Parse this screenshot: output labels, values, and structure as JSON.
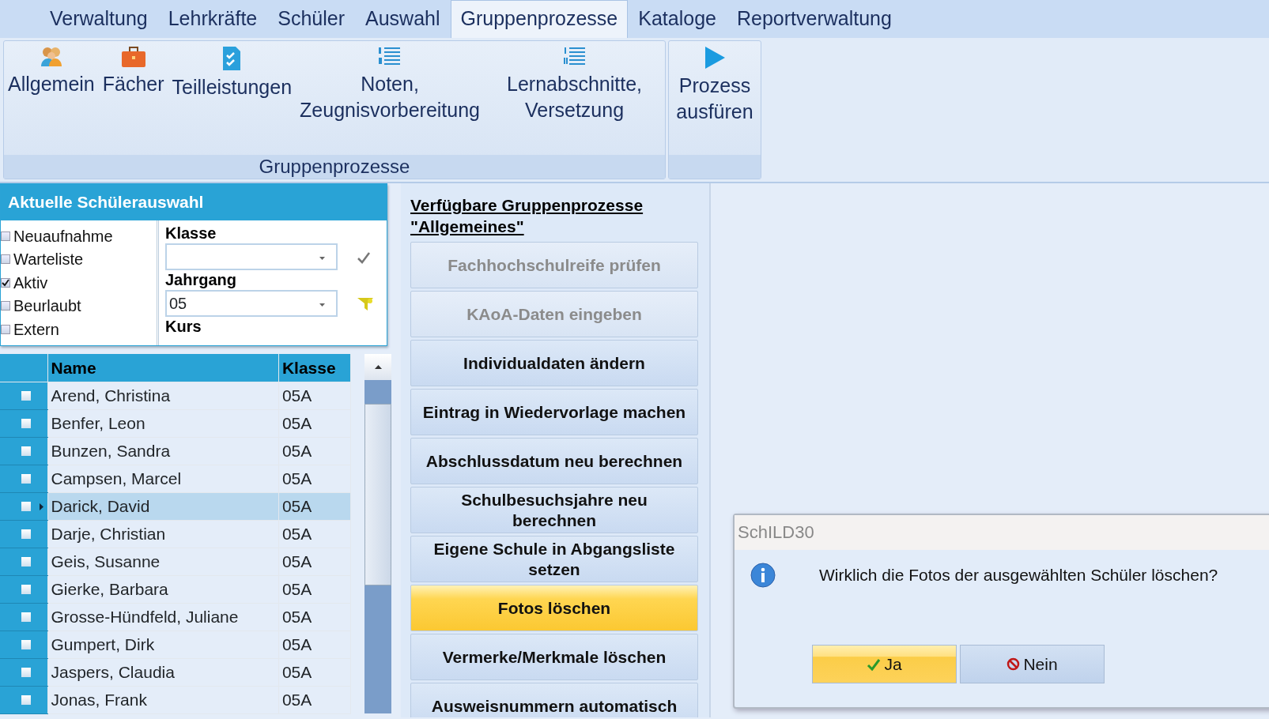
{
  "menu_tabs": [
    {
      "label": "Verwaltung",
      "selected": false
    },
    {
      "label": "Lehrkräfte",
      "selected": false
    },
    {
      "label": "Schüler",
      "selected": false
    },
    {
      "label": "Auswahl",
      "selected": false
    },
    {
      "label": "Gruppenprozesse",
      "selected": true
    },
    {
      "label": "Kataloge",
      "selected": false
    },
    {
      "label": "Reportverwaltung",
      "selected": false
    }
  ],
  "ribbon": {
    "groups": [
      {
        "label": "Gruppenprozesse",
        "items": [
          {
            "label": "Allgemein",
            "kind": "people"
          },
          {
            "label": "Fächer",
            "kind": "briefcase"
          },
          {
            "label": "Teilleistungen",
            "kind": "checklist"
          },
          {
            "label": "Noten, Zeugnisvorbereitung",
            "kind": "numbered"
          },
          {
            "label": "Lernabschnitte, Versetzung",
            "kind": "roman"
          }
        ]
      },
      {
        "items": [
          {
            "label": "Prozess ausfüren",
            "kind": "play"
          }
        ]
      }
    ]
  },
  "selection_panel": {
    "title": "Aktuelle Schülerauswahl",
    "statuses": [
      {
        "label": "Neuaufnahme",
        "checked": false
      },
      {
        "label": "Warteliste",
        "checked": false
      },
      {
        "label": "Aktiv",
        "checked": true
      },
      {
        "label": "Beurlaubt",
        "checked": false
      },
      {
        "label": "Extern",
        "checked": false
      }
    ],
    "fields": [
      {
        "label": "Klasse",
        "kind": "apply"
      },
      {
        "label": "Jahrgang",
        "value": "05",
        "kind": "filter"
      }
    ],
    "cut_label": "Kurs"
  },
  "student_table": {
    "columns": [
      "Name",
      "Klasse"
    ],
    "rows": [
      {
        "name": "Arend, Christina",
        "klasse": "05A",
        "selected": false,
        "checked": false
      },
      {
        "name": "Benfer, Leon",
        "klasse": "05A",
        "selected": false,
        "checked": false
      },
      {
        "name": "Bunzen, Sandra",
        "klasse": "05A",
        "selected": false,
        "checked": false
      },
      {
        "name": "Campsen, Marcel",
        "klasse": "05A",
        "selected": false,
        "checked": false
      },
      {
        "name": "Darick, David",
        "klasse": "05A",
        "selected": true,
        "checked": false
      },
      {
        "name": "Darje, Christian",
        "klasse": "05A",
        "selected": false,
        "checked": false
      },
      {
        "name": "Geis, Susanne",
        "klasse": "05A",
        "selected": false,
        "checked": false
      },
      {
        "name": "Gierke, Barbara",
        "klasse": "05A",
        "selected": false,
        "checked": false
      },
      {
        "name": "Grosse-Hündfeld, Juliane",
        "klasse": "05A",
        "selected": false,
        "checked": false
      },
      {
        "name": "Gumpert, Dirk",
        "klasse": "05A",
        "selected": false,
        "checked": false
      },
      {
        "name": "Jaspers, Claudia",
        "klasse": "05A",
        "selected": false,
        "checked": false
      },
      {
        "name": "Jonas, Frank",
        "klasse": "05A",
        "selected": false,
        "checked": false
      }
    ]
  },
  "process_panel": {
    "title": "Verfügbare Gruppenprozesse \"Allgemeines\"",
    "buttons": [
      {
        "label": "Fachhochschulreife prüfen",
        "disabled": true,
        "highlighted": false
      },
      {
        "label": "KAoA-Daten eingeben",
        "disabled": true,
        "highlighted": false
      },
      {
        "label": "Individualdaten ändern",
        "disabled": false,
        "highlighted": false
      },
      {
        "label": "Eintrag in Wiedervorlage machen",
        "disabled": false,
        "highlighted": false
      },
      {
        "label": "Abschlussdatum neu berechnen",
        "disabled": false,
        "highlighted": false
      },
      {
        "label": "Schulbesuchsjahre neu berechnen",
        "disabled": false,
        "highlighted": false
      },
      {
        "label": "Eigene Schule in Abgangsliste setzen",
        "disabled": false,
        "highlighted": false
      },
      {
        "label": "Fotos löschen",
        "disabled": false,
        "highlighted": true
      },
      {
        "label": "Vermerke/Merkmale löschen",
        "disabled": false,
        "highlighted": false
      },
      {
        "label": "Ausweisnummern automatisch",
        "disabled": false,
        "highlighted": false
      }
    ]
  },
  "dialog": {
    "title": "SchILD30",
    "message": "Wirklich die Fotos der ausgewählten Schüler löschen?",
    "buttons": [
      {
        "label": "Ja",
        "kind": "yes",
        "default": true
      },
      {
        "label": "Nein",
        "kind": "no",
        "default": false
      }
    ]
  }
}
